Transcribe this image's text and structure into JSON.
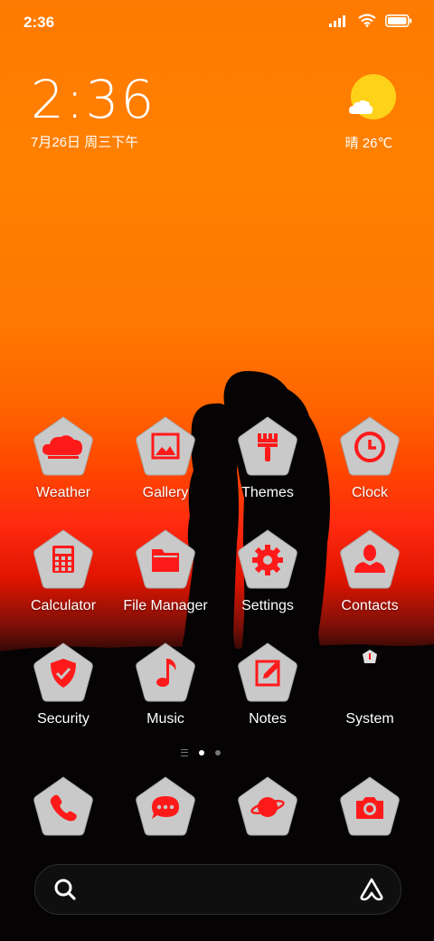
{
  "status_bar": {
    "time": "2:36",
    "icons": [
      "signal-icon",
      "wifi-icon",
      "battery-icon"
    ]
  },
  "clock_widget": {
    "time": "2:36",
    "date": "7月26日 周三下午"
  },
  "weather_widget": {
    "icon": "sun-cloud-icon",
    "text": "晴 26℃"
  },
  "apps": [
    {
      "label": "Weather",
      "icon": "cloud-icon"
    },
    {
      "label": "Gallery",
      "icon": "image-icon"
    },
    {
      "label": "Themes",
      "icon": "paintbrush-icon"
    },
    {
      "label": "Clock",
      "icon": "clock-icon"
    },
    {
      "label": "Calculator",
      "icon": "calculator-icon"
    },
    {
      "label": "File Manager",
      "icon": "folder-icon"
    },
    {
      "label": "Settings",
      "icon": "gear-icon"
    },
    {
      "label": "Contacts",
      "icon": "person-icon"
    },
    {
      "label": "Security",
      "icon": "shield-icon"
    },
    {
      "label": "Music",
      "icon": "music-note-icon"
    },
    {
      "label": "Notes",
      "icon": "note-edit-icon"
    },
    {
      "label": "System",
      "icon": "system-folder-icon"
    }
  ],
  "page_indicator": {
    "pages": 2,
    "current": 1
  },
  "dock": [
    {
      "icon": "phone-icon"
    },
    {
      "icon": "message-icon"
    },
    {
      "icon": "planet-browser-icon"
    },
    {
      "icon": "camera-icon"
    }
  ],
  "search_bar": {
    "left_icon": "search-icon",
    "right_icon": "assistant-icon"
  },
  "colors": {
    "accent": "#ff1a1a",
    "icon_bg": "#c8c8c8"
  }
}
